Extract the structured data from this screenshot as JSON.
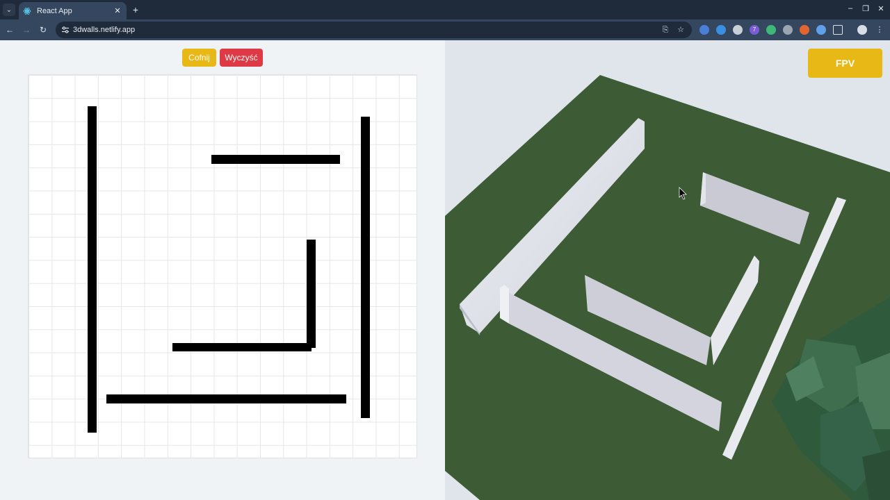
{
  "browser": {
    "tab_title": "React App",
    "url": "3dwalls.netlify.app",
    "extension_badge": "7"
  },
  "editor": {
    "undo_label": "Cofnij",
    "clear_label": "Wyczyść"
  },
  "viewport": {
    "fpv_label": "FPV"
  },
  "colors": {
    "accent_yellow": "#e8b816",
    "danger_red": "#dd3a45",
    "ground_green": "#3d5c36",
    "wall_gray": "#d9dbe4"
  }
}
